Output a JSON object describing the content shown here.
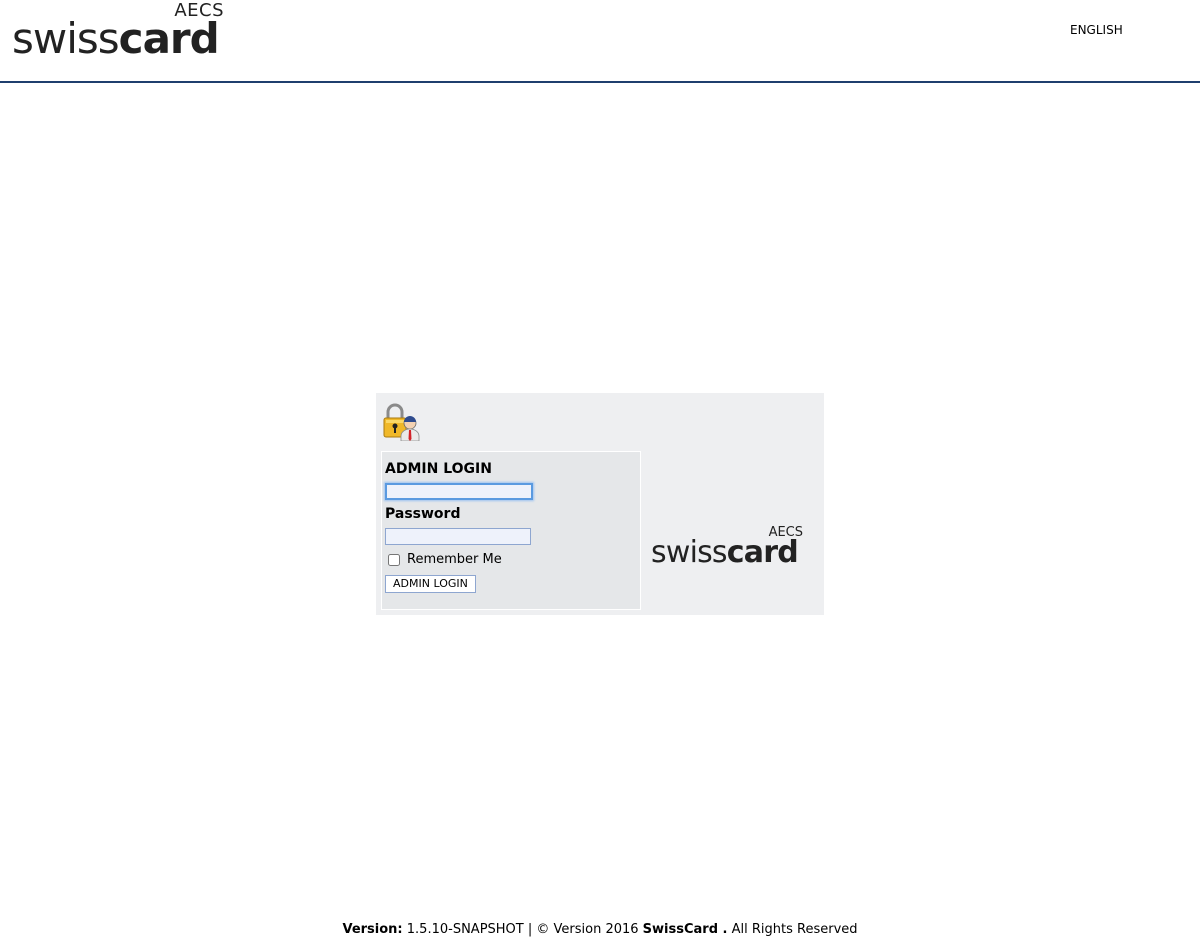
{
  "header": {
    "logo": {
      "superscript": "AECS",
      "word_light": "swiss",
      "word_bold": "card"
    },
    "language": "ENGLISH"
  },
  "login": {
    "lock_icon": "lock-user-icon",
    "username_label": "ADMIN LOGIN",
    "username_value": "",
    "password_label": "Password",
    "password_value": "",
    "remember_label": "Remember Me",
    "remember_checked": false,
    "submit_label": "ADMIN LOGIN",
    "logo": {
      "superscript": "AECS",
      "word_light": "swiss",
      "word_bold": "card"
    }
  },
  "footer": {
    "version_label": "Version:",
    "version_value": "1.5.10-SNAPSHOT | © Version 2016",
    "company": "SwissCard .",
    "rights": "All Rights Reserved"
  },
  "colors": {
    "header_rule": "#1f3f6e",
    "panel_bg": "#eeeff1",
    "form_bg": "#e5e7e9",
    "input_border": "#8ea6d0",
    "focus_border": "#5a9ae0"
  }
}
